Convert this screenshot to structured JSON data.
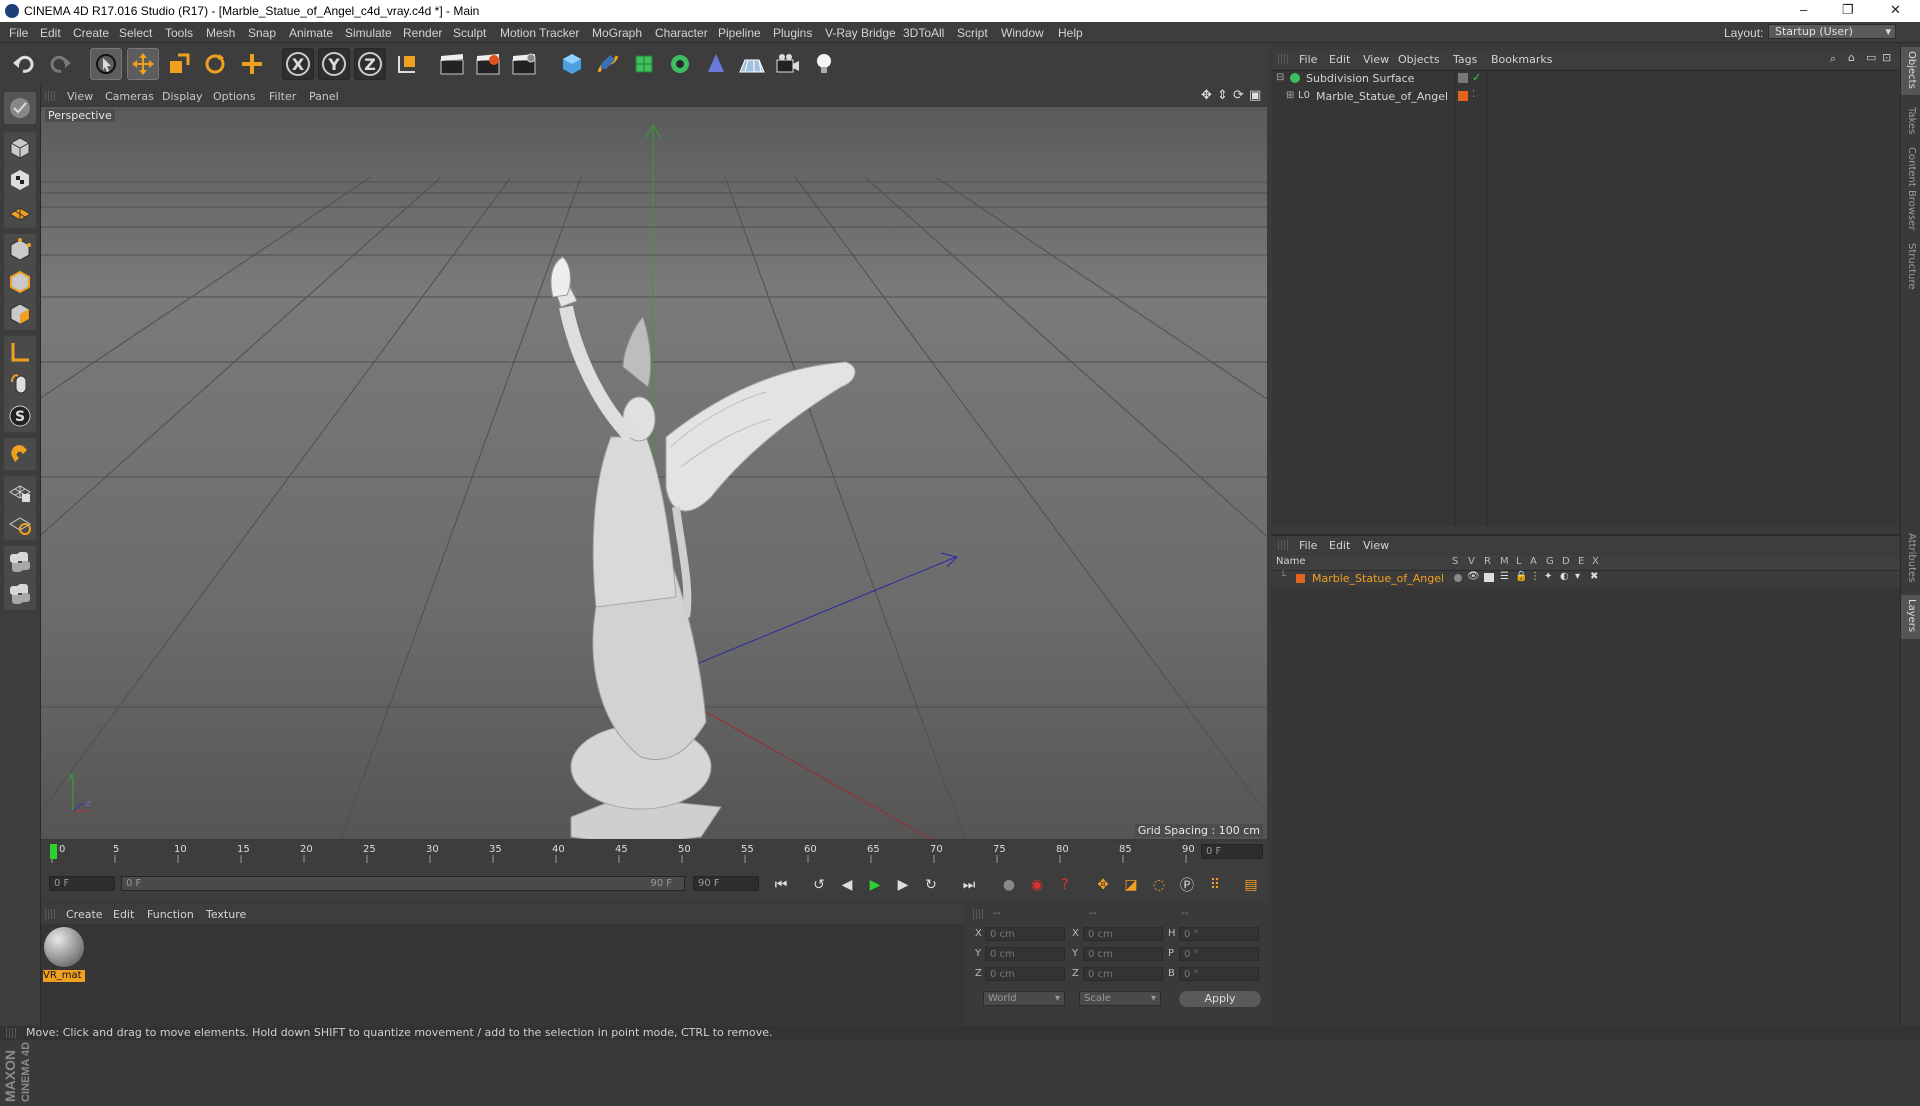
{
  "window": {
    "title": "CINEMA 4D R17.016 Studio (R17) - [Marble_Statue_of_Angel_c4d_vray.c4d *] - Main",
    "controls": [
      "–",
      "❐",
      "✕"
    ]
  },
  "menu": [
    "File",
    "Edit",
    "Create",
    "Select",
    "Tools",
    "Mesh",
    "Snap",
    "Animate",
    "Simulate",
    "Render",
    "Sculpt",
    "Motion Tracker",
    "MoGraph",
    "Character",
    "Pipeline",
    "Plugins",
    "V-Ray Bridge",
    "3DToAll",
    "Script",
    "Window",
    "Help"
  ],
  "layout": {
    "label": "Layout:",
    "value": "Startup (User)"
  },
  "toolbar": {
    "undo_icon": "undo-icon",
    "redo_icon": "redo-icon",
    "axis_x": "X",
    "axis_y": "Y",
    "axis_z": "Z"
  },
  "viewport": {
    "menu": [
      "View",
      "Cameras",
      "Display",
      "Options",
      "Filter",
      "Panel"
    ],
    "camera_label": "Perspective",
    "grid_spacing": "Grid Spacing : 100 cm",
    "axis_y_label": "y",
    "axis_z_label": "z"
  },
  "timeline": {
    "ticks": [
      "0",
      "5",
      "10",
      "15",
      "20",
      "25",
      "30",
      "35",
      "40",
      "45",
      "50",
      "55",
      "60",
      "65",
      "70",
      "75",
      "80",
      "85",
      "90"
    ],
    "current_frame": "0 F"
  },
  "transport": {
    "start_field": "0 F",
    "range_start": "0 F",
    "range_end": "90 F",
    "end_field": "90 F"
  },
  "material_manager": {
    "menu": [
      "Create",
      "Edit",
      "Function",
      "Texture"
    ],
    "materials": [
      {
        "name": "VR_mat"
      }
    ]
  },
  "coordinates": {
    "headers": [
      "--",
      "--",
      "--"
    ],
    "rows": [
      {
        "a": "X",
        "a_val": "0 cm",
        "b": "X",
        "b_val": "0 cm",
        "c": "H",
        "c_val": "0 °"
      },
      {
        "a": "Y",
        "a_val": "0 cm",
        "b": "Y",
        "b_val": "0 cm",
        "c": "P",
        "c_val": "0 °"
      },
      {
        "a": "Z",
        "a_val": "0 cm",
        "b": "Z",
        "b_val": "0 cm",
        "c": "B",
        "c_val": "0 °"
      }
    ],
    "mode_world": "World",
    "mode_scale": "Scale",
    "apply": "Apply"
  },
  "object_manager": {
    "menu": [
      "File",
      "Edit",
      "View",
      "Objects",
      "Tags",
      "Bookmarks"
    ],
    "objects": [
      {
        "name": "Subdivision Surface",
        "expanded": true
      },
      {
        "name": "Marble_Statue_of_Angel",
        "expanded": false
      }
    ]
  },
  "layer_manager": {
    "menu": [
      "File",
      "Edit",
      "View"
    ],
    "columns": [
      "Name",
      "S",
      "V",
      "R",
      "M",
      "L",
      "A",
      "G",
      "D",
      "E",
      "X"
    ],
    "layers": [
      {
        "name": "Marble_Statue_of_Angel",
        "color": "#e0641e"
      }
    ]
  },
  "right_tabs": [
    "Objects",
    "Takes",
    "Content Browser",
    "Structure",
    "Attributes",
    "Layers"
  ],
  "status": "Move: Click and drag to move elements. Hold down SHIFT to quantize movement / add to the selection in point mode, CTRL to remove.",
  "brand": {
    "maxon": "MAXON",
    "cinema": "CINEMA 4D"
  },
  "colors": {
    "accent": "#f0a020",
    "layer_orange": "#e0641e",
    "play_green": "#2fd12f"
  }
}
